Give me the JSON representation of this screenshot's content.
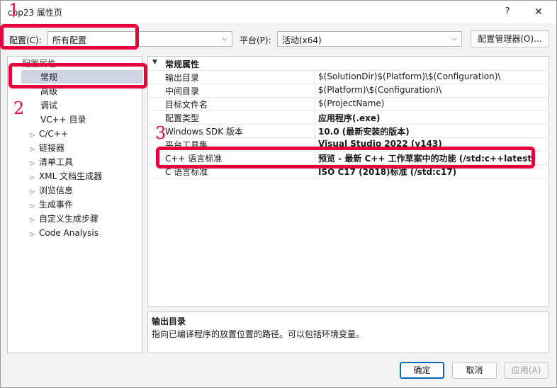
{
  "window": {
    "title": "cpp23 属性页",
    "help_icon": "?",
    "close_icon": "✕"
  },
  "config": {
    "label": "配置(C):",
    "value": "所有配置"
  },
  "platform": {
    "label": "平台(P):",
    "value": "活动(x64)"
  },
  "config_manager_label": "配置管理器(O)...",
  "tree": {
    "root": "配置属性",
    "items": [
      {
        "label": "常规",
        "expandable": false,
        "selected": true
      },
      {
        "label": "高级",
        "expandable": false
      },
      {
        "label": "调试",
        "expandable": false
      },
      {
        "label": "VC++ 目录",
        "expandable": false
      },
      {
        "label": "C/C++",
        "expandable": true
      },
      {
        "label": "链接器",
        "expandable": true
      },
      {
        "label": "清单工具",
        "expandable": true
      },
      {
        "label": "XML 文档生成器",
        "expandable": true
      },
      {
        "label": "浏览信息",
        "expandable": true
      },
      {
        "label": "生成事件",
        "expandable": true
      },
      {
        "label": "自定义生成步骤",
        "expandable": true
      },
      {
        "label": "Code Analysis",
        "expandable": true
      }
    ]
  },
  "grid": {
    "category": "常规属性",
    "rows": [
      {
        "name": "输出目录",
        "value": "$(SolutionDir)$(Platform)\\$(Configuration)\\",
        "bold": false
      },
      {
        "name": "中间目录",
        "value": "$(Platform)\\$(Configuration)\\",
        "bold": false
      },
      {
        "name": "目标文件名",
        "value": "$(ProjectName)",
        "bold": false
      },
      {
        "name": "配置类型",
        "value": "应用程序(.exe)",
        "bold": true
      },
      {
        "name": "Windows SDK 版本",
        "value": "10.0 (最新安装的版本)",
        "bold": true
      },
      {
        "name": "平台工具集",
        "value": "Visual Studio 2022 (v143)",
        "bold": true
      },
      {
        "name": "C++ 语言标准",
        "value": "预览 - 最新 C++ 工作草案中的功能 (/std:c++latest)",
        "bold": true
      },
      {
        "name": "C 语言标准",
        "value": "ISO C17 (2018)标准 (/std:c17)",
        "bold": true
      }
    ]
  },
  "description": {
    "title": "输出目录",
    "text": "指向已编译程序的放置位置的路径。可以包括环境变量。"
  },
  "buttons": {
    "ok": "确定",
    "cancel": "取消",
    "apply": "应用(A)"
  },
  "annotations": {
    "n1": "1",
    "n2": "2",
    "n3": "3",
    "color": "#e8003c"
  },
  "icons": {
    "dropdown": "chevron-down-icon",
    "expand": "chevron-right-icon",
    "collapse": "chevron-down-icon"
  }
}
